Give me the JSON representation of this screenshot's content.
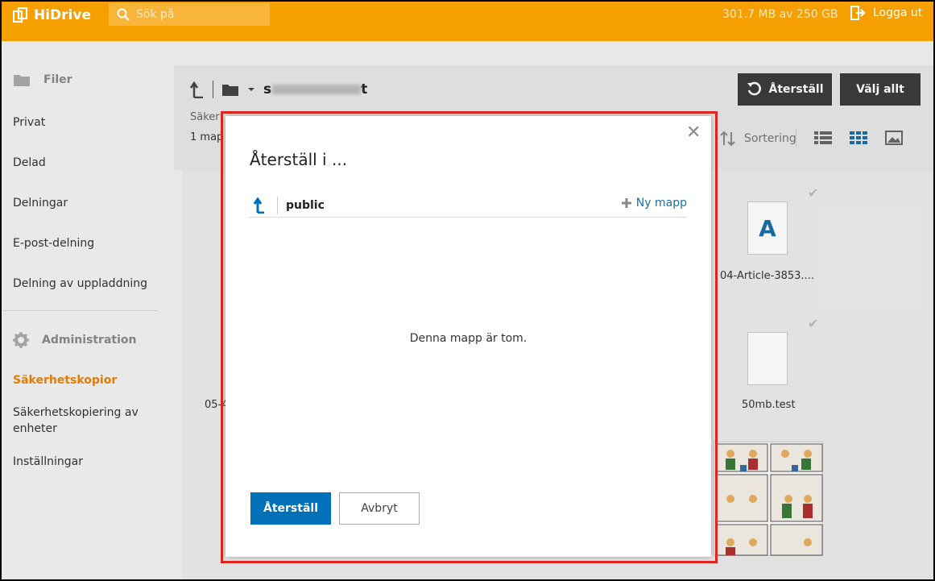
{
  "header": {
    "logo_text": "HiDrive",
    "search_placeholder": "Sök på",
    "storage": "301.7 MB av 250 GB",
    "logout_label": "Logga ut"
  },
  "sidebar": {
    "files_section": "Filer",
    "items": [
      "Privat",
      "Delad",
      "Delningar",
      "E-post-delning",
      "Delning av uppladdning"
    ],
    "admin_section": "Administration",
    "admin_items": [
      "Säkerhetskopior",
      "Säkerhetskopiering av enheter",
      "Inställningar"
    ]
  },
  "main": {
    "path_prefix": "s",
    "path_suffix": "t",
    "subline1": "Säker",
    "subline2": "1 map",
    "restore_button": "Återställ",
    "select_all_button": "Välj allt",
    "sort_label": "Sortering",
    "files": [
      {
        "label": "04-Article-3853...."
      },
      {
        "label": "50mb.test"
      },
      {
        "label": "05-4"
      }
    ],
    "doc_letter": "A"
  },
  "modal": {
    "title": "Återställ i ...",
    "folder_name": "public",
    "new_folder_label": "Ny mapp",
    "empty_message": "Denna mapp är tom.",
    "confirm_button": "Återställ",
    "cancel_button": "Avbryt",
    "close_symbol": "✕"
  },
  "colors": {
    "header": "#f5a000",
    "accent_blue": "#0071b9",
    "active_orange": "#f08000",
    "highlight_red": "#e0261f"
  }
}
